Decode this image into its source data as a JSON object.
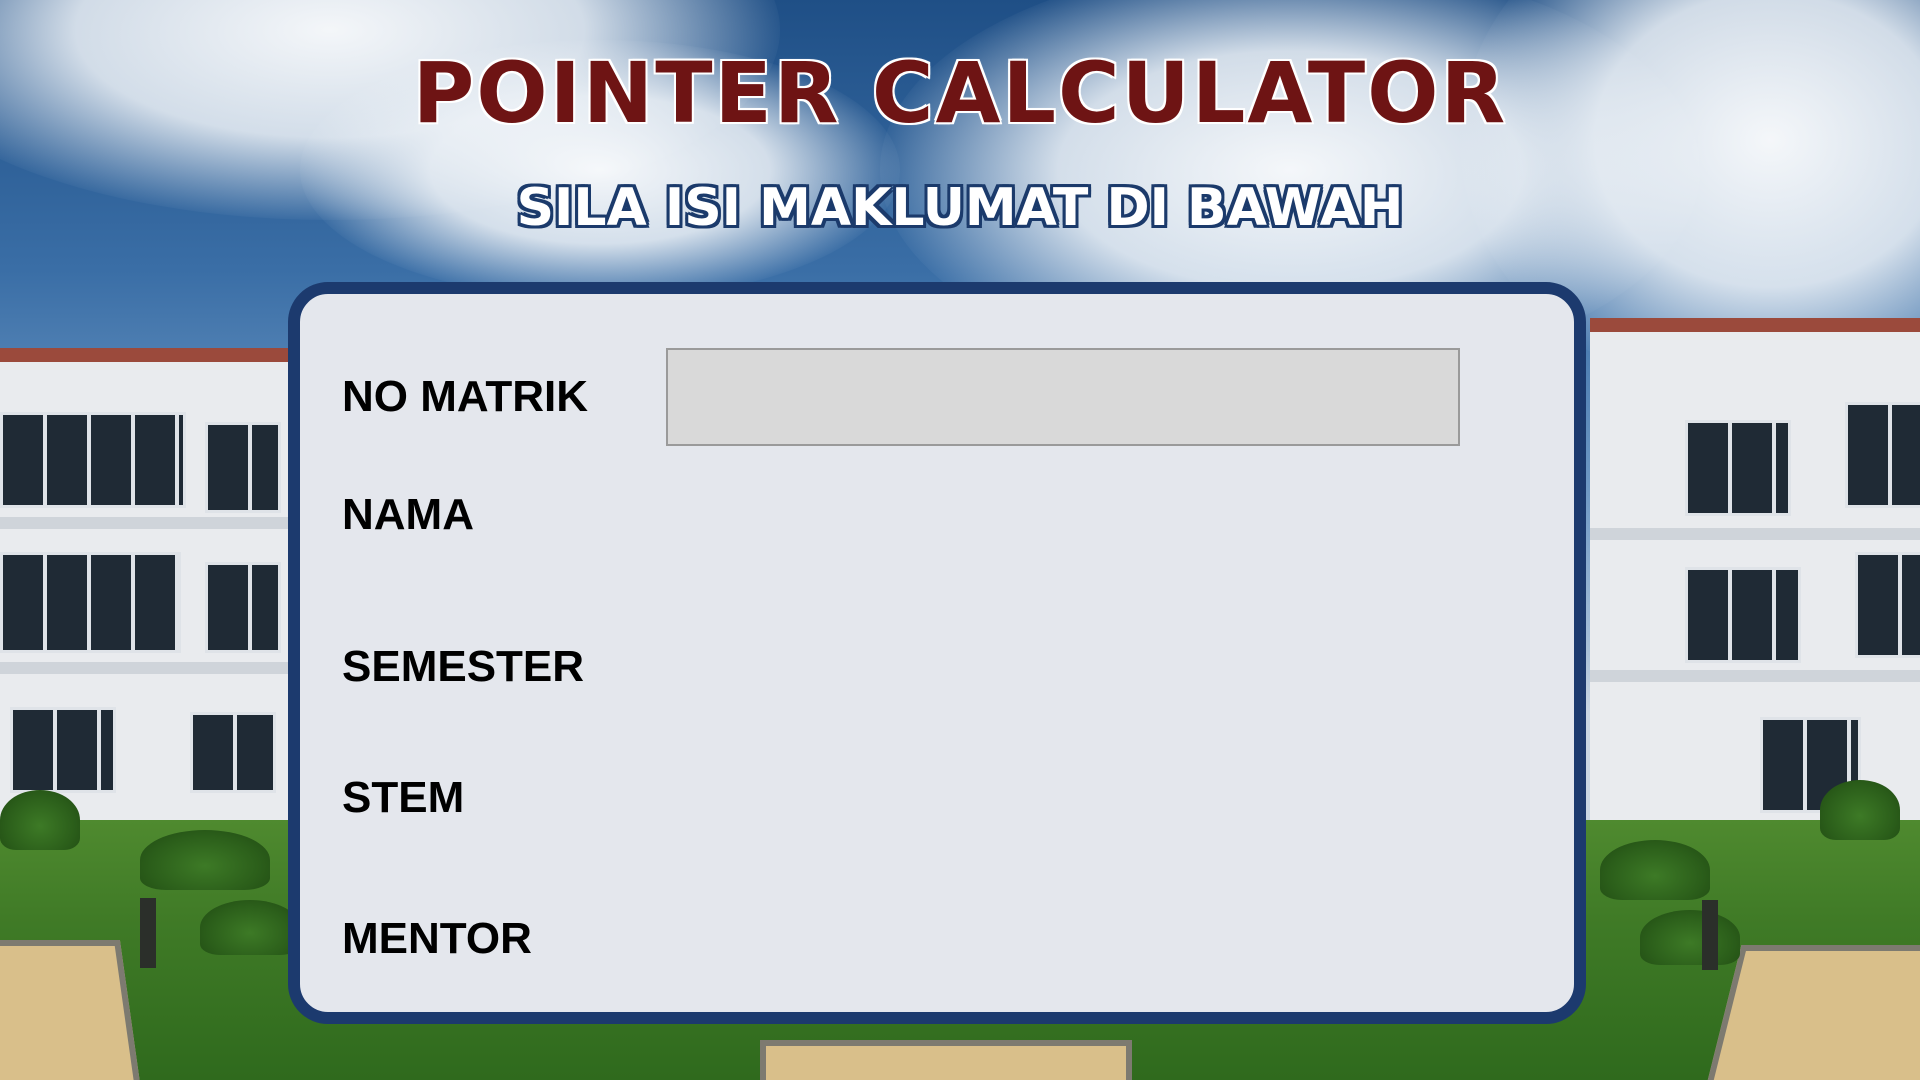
{
  "header": {
    "title": "POINTER CALCULATOR",
    "subtitle": "SILA ISI MAKLUMAT DI BAWAH"
  },
  "form": {
    "fields": [
      {
        "label": "NO MATRIK",
        "value": "",
        "placeholder": ""
      },
      {
        "label": "NAMA"
      },
      {
        "label": "SEMESTER"
      },
      {
        "label": "STEM"
      },
      {
        "label": "MENTOR"
      }
    ]
  },
  "colors": {
    "title_text": "#6e1414",
    "subtitle_outline": "#1b3a6b",
    "card_border": "#1c3a6e",
    "card_background": "#e4e7ed",
    "input_background": "#d9d9d9"
  }
}
